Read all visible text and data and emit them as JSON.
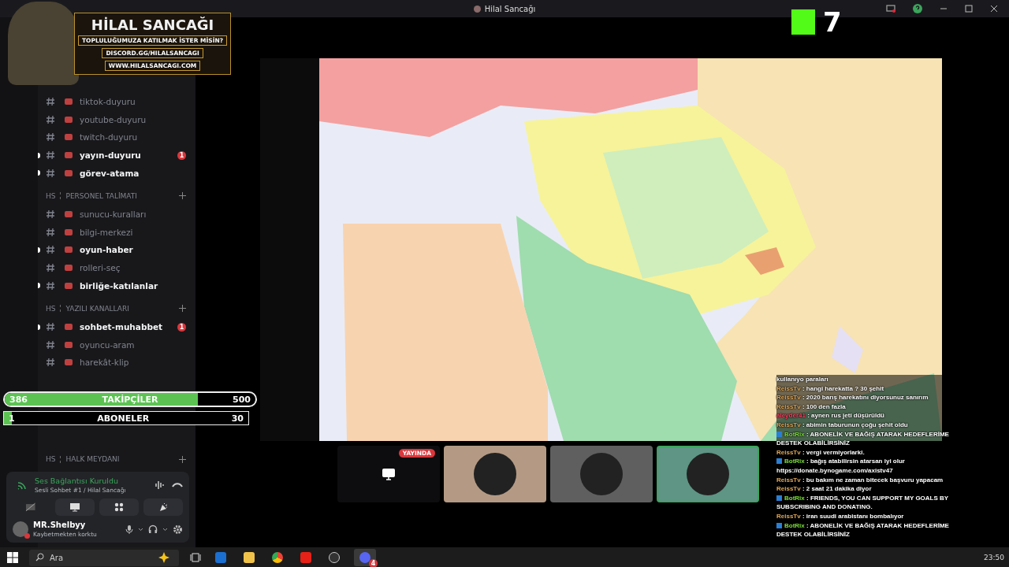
{
  "window": {
    "title": "Hilal Sancağı"
  },
  "overlay_banner": {
    "title": "HİLAL SANCAĞI",
    "tagline": "TOPLULUĞUMUZA KATILMAK İSTER MİSİN?",
    "discord": "DISCORD.GG/HILALSANCAGI",
    "website": "WWW.HILALSANCAGI.COM"
  },
  "kick_badge": {
    "count": "7"
  },
  "channels": [
    {
      "kind": "channel",
      "name": "tiktok-duyuru",
      "unread": false
    },
    {
      "kind": "channel",
      "name": "youtube-duyuru",
      "unread": false
    },
    {
      "kind": "channel",
      "name": "twitch-duyuru",
      "unread": false
    },
    {
      "kind": "channel",
      "name": "yayın-duyuru",
      "unread": true,
      "badge": "1"
    },
    {
      "kind": "channel",
      "name": "görev-atama",
      "unread": true
    },
    {
      "kind": "category",
      "prefix": "HS",
      "name": "PERSONEL TALİMATI"
    },
    {
      "kind": "channel",
      "name": "sunucu-kuralları",
      "unread": false
    },
    {
      "kind": "channel",
      "name": "bilgi-merkezi",
      "unread": false
    },
    {
      "kind": "channel",
      "name": "oyun-haber",
      "unread": true
    },
    {
      "kind": "channel",
      "name": "rolleri-seç",
      "unread": false
    },
    {
      "kind": "channel",
      "name": "birliğe-katılanlar",
      "unread": true
    },
    {
      "kind": "category",
      "prefix": "HS",
      "name": "YAZILI KANALLARI"
    },
    {
      "kind": "channel",
      "name": "sohbet-muhabbet",
      "unread": true,
      "badge": "1"
    },
    {
      "kind": "channel",
      "name": "oyuncu-aram",
      "unread": false
    },
    {
      "kind": "channel",
      "name": "harekât-klip",
      "unread": false
    }
  ],
  "bottom_category": {
    "prefix": "HS",
    "name": "HALK MEYDANI"
  },
  "goals": [
    {
      "label": "TAKİPÇİLER",
      "current": "386",
      "target": "500",
      "level": 0.772
    },
    {
      "label": "ABONELER",
      "current": "1",
      "target": "30",
      "level": 0.033
    }
  ],
  "voice": {
    "status": "Ses Bağlantısı Kuruldu",
    "channel": "Sesli Sohbet #1 / Hilal Sancağı"
  },
  "user": {
    "name": "MR.Shelbyy",
    "status": "Kaybetmekten korktu"
  },
  "participants": [
    {
      "kind": "screen",
      "badge": "YAYINDA",
      "selected": false
    },
    {
      "kind": "avatar",
      "color": "#b49a84",
      "selected": false
    },
    {
      "kind": "avatar",
      "color": "#5f5f5f",
      "selected": false
    },
    {
      "kind": "avatar",
      "color": "#5e9585",
      "selected": true
    }
  ],
  "chat": [
    {
      "kind": "continuation",
      "text": "kullanıyo paraları"
    },
    {
      "kind": "message",
      "user": "ReissTv",
      "color": "#e0a85a",
      "bot": false,
      "text": ": hangi harekatta ? 30 şehit"
    },
    {
      "kind": "message",
      "user": "ReissTv",
      "color": "#e0a85a",
      "bot": false,
      "text": ": 2020 barış harekatını diyorsunuz sanırım"
    },
    {
      "kind": "message",
      "user": "ReissTv",
      "color": "#e0a85a",
      "bot": false,
      "text": ": 100 den fazla"
    },
    {
      "kind": "message",
      "user": "aleyder41",
      "color": "#ff4060",
      "bot": false,
      "text": ": aynen rus jeti düşürüldü"
    },
    {
      "kind": "message",
      "user": "ReissTv",
      "color": "#e0a85a",
      "bot": false,
      "text": ": abimin taburunun çoğu şehit oldu"
    },
    {
      "kind": "message",
      "user": "BotRix",
      "color": "#7ddc3c",
      "bot": true,
      "text": ": ABONELİK VE BAĞIŞ ATARAK HEDEFLERİME DESTEK OLABİLİRSİNİZ"
    },
    {
      "kind": "message",
      "user": "ReissTv",
      "color": "#e0a85a",
      "bot": false,
      "text": ": vergi vermiyorlarki."
    },
    {
      "kind": "message",
      "user": "BotRix",
      "color": "#7ddc3c",
      "bot": true,
      "text": ": bağış atabilirsin atarsan iyi olur https://donate.bynogame.com/axistv47"
    },
    {
      "kind": "message",
      "user": "ReissTv",
      "color": "#e0a85a",
      "bot": false,
      "text": ": bu bakım ne zaman bitecek başvuru yapacam"
    },
    {
      "kind": "message",
      "user": "ReissTv",
      "color": "#e0a85a",
      "bot": false,
      "text": ": 2 saat 21 dakika diyor"
    },
    {
      "kind": "message",
      "user": "BotRix",
      "color": "#7ddc3c",
      "bot": true,
      "text": ": FRIENDS, YOU CAN SUPPORT MY GOALS BY SUBSCRIBING AND DONATING."
    },
    {
      "kind": "message",
      "user": "ReissTv",
      "color": "#e0a85a",
      "bot": false,
      "text": ": iran suudi arabistanı bombalıyor"
    },
    {
      "kind": "message",
      "user": "BotRix",
      "color": "#7ddc3c",
      "bot": true,
      "text": ": ABONELİK VE BAĞIŞ ATARAK HEDEFLERİME DESTEK OLABİLİRSİNİZ"
    }
  ],
  "taskbar": {
    "search_placeholder": "Ara",
    "discord_badge": "4",
    "clock": "23:50"
  }
}
